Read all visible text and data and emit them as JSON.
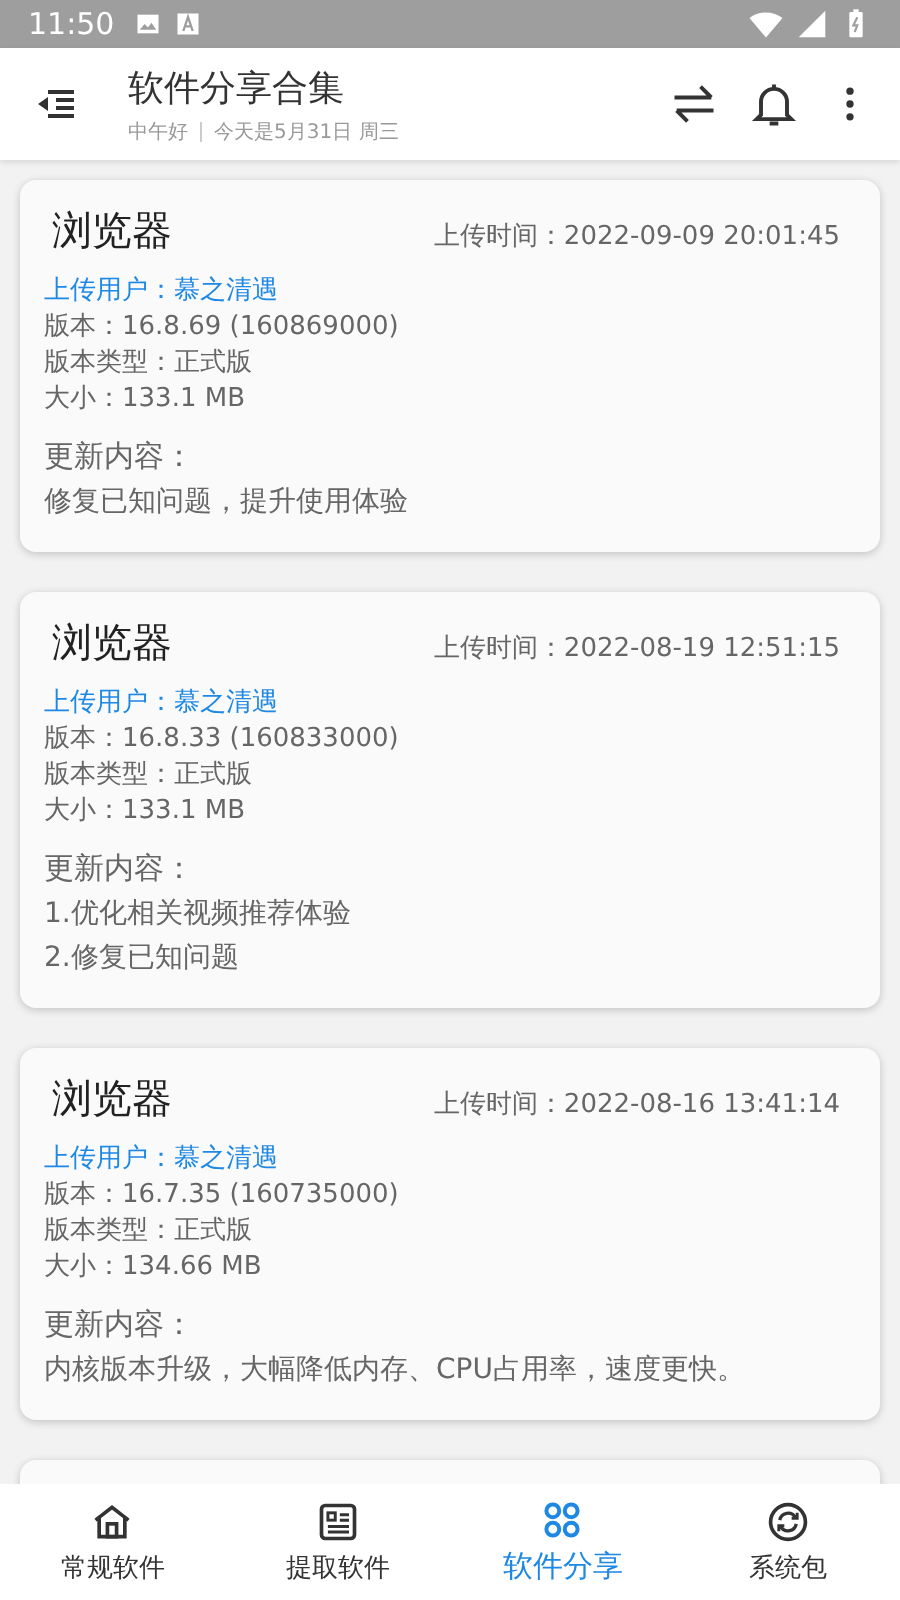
{
  "status_bar": {
    "time": "11:50"
  },
  "app_bar": {
    "title": "软件分享合集",
    "greeting": "中午好",
    "date": "今天是5月31日 周三"
  },
  "cards": [
    {
      "name": "浏览器",
      "upload_time": "上传时间：2022-09-09 20:01:45",
      "uploader": "上传用户：慕之清遇",
      "version": "版本：16.8.69 (160869000)",
      "version_type": "版本类型：正式版",
      "size": "大小：133.1 MB",
      "changelog_label": "更新内容：",
      "changelog": [
        "修复已知问题，提升使用体验"
      ]
    },
    {
      "name": "浏览器",
      "upload_time": "上传时间：2022-08-19 12:51:15",
      "uploader": "上传用户：慕之清遇",
      "version": "版本：16.8.33 (160833000)",
      "version_type": "版本类型：正式版",
      "size": "大小：133.1 MB",
      "changelog_label": "更新内容：",
      "changelog": [
        "1.优化相关视频推荐体验",
        "2.修复已知问题"
      ]
    },
    {
      "name": "浏览器",
      "upload_time": "上传时间：2022-08-16 13:41:14",
      "uploader": "上传用户：慕之清遇",
      "version": "版本：16.7.35 (160735000)",
      "version_type": "版本类型：正式版",
      "size": "大小：134.66 MB",
      "changelog_label": "更新内容：",
      "changelog": [
        "内核版本升级，大幅降低内存、CPU占用率，速度更快。"
      ]
    }
  ],
  "bottom_nav": [
    {
      "kind": "home",
      "label": "常规软件",
      "selected": false
    },
    {
      "kind": "list",
      "label": "提取软件",
      "selected": false
    },
    {
      "kind": "circles",
      "label": "软件分享",
      "selected": true
    },
    {
      "kind": "refresh",
      "label": "系统包",
      "selected": false
    }
  ]
}
